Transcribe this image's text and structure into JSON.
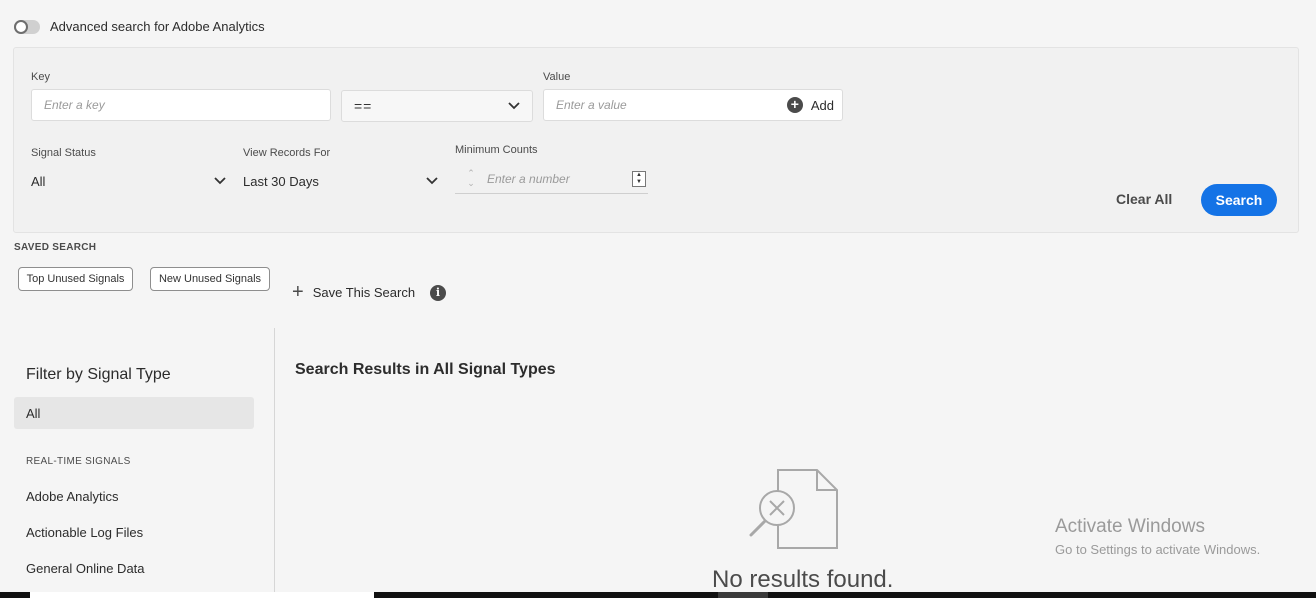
{
  "advanced_search": {
    "label": "Advanced search for Adobe Analytics",
    "enabled": false
  },
  "filters": {
    "key_label": "Key",
    "key_placeholder": "Enter a key",
    "operator_value": "==",
    "value_label": "Value",
    "value_placeholder": "Enter a value",
    "add_label": "Add",
    "signal_status_label": "Signal Status",
    "signal_status_value": "All",
    "view_records_label": "View Records For",
    "view_records_value": "Last 30 Days",
    "min_counts_label": "Minimum Counts",
    "min_counts_placeholder": "Enter a number",
    "clear_label": "Clear All",
    "search_label": "Search"
  },
  "saved_search": {
    "title": "SAVED SEARCH",
    "chips": [
      "Top Unused Signals",
      "New Unused Signals"
    ],
    "save_label": "Save This Search"
  },
  "sidebar": {
    "title": "Filter by Signal Type",
    "selected": "All",
    "section": "REAL-TIME SIGNALS",
    "items": [
      "Adobe Analytics",
      "Actionable Log Files",
      "General Online Data"
    ]
  },
  "results": {
    "title": "Search Results in All Signal Types",
    "empty_text": "No results found."
  },
  "watermark": {
    "line1": "Activate Windows",
    "line2": "Go to Settings to activate Windows."
  },
  "colors": {
    "accent": "#1473e6",
    "background": "#f5f5f5"
  }
}
